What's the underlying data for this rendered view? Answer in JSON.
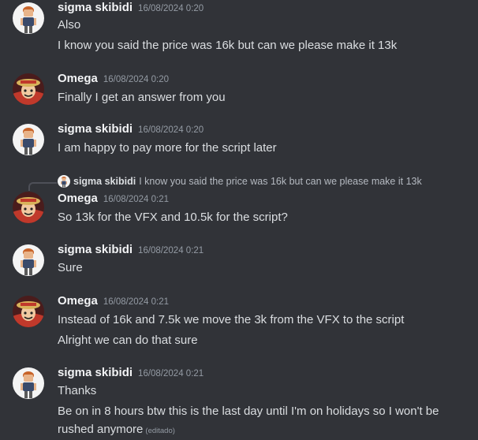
{
  "messages": [
    {
      "author": "sigma skibidi",
      "avatar": "cartoon-character-avatar",
      "timestamp": "16/08/2024 0:20",
      "lines": [
        "Also",
        "I know you said the price was 16k but can we please make it 13k"
      ]
    },
    {
      "author": "Omega",
      "avatar": "anime-pirate-avatar",
      "timestamp": "16/08/2024 0:20",
      "lines": [
        "Finally I get an answer from you"
      ]
    },
    {
      "author": "sigma skibidi",
      "avatar": "cartoon-character-avatar",
      "timestamp": "16/08/2024 0:20",
      "lines": [
        "I am happy to pay more for the script later"
      ]
    },
    {
      "author": "Omega",
      "avatar": "anime-pirate-avatar",
      "timestamp": "16/08/2024 0:21",
      "reply_to": {
        "author": "sigma skibidi",
        "text": "I know you said the price was 16k but can we please make it 13k"
      },
      "lines": [
        "So 13k for the VFX and 10.5k for the script?"
      ]
    },
    {
      "author": "sigma skibidi",
      "avatar": "cartoon-character-avatar",
      "timestamp": "16/08/2024 0:21",
      "lines": [
        "Sure"
      ]
    },
    {
      "author": "Omega",
      "avatar": "anime-pirate-avatar",
      "timestamp": "16/08/2024 0:21",
      "lines": [
        "Instead of 16k and 7.5k we move the 3k from the VFX to the script",
        "Alright we can do that sure"
      ]
    },
    {
      "author": "sigma skibidi",
      "avatar": "cartoon-character-avatar",
      "timestamp": "16/08/2024 0:21",
      "lines": [
        "Thanks",
        "Be on in 8 hours btw this is the last day until I'm on holidays so I won't be",
        "rushed anymore"
      ],
      "edited_label": "(editado)"
    }
  ],
  "colors": {
    "background": "#313338",
    "username": "#f2f3f5",
    "text": "#dbdee1",
    "muted": "#949ba4"
  }
}
